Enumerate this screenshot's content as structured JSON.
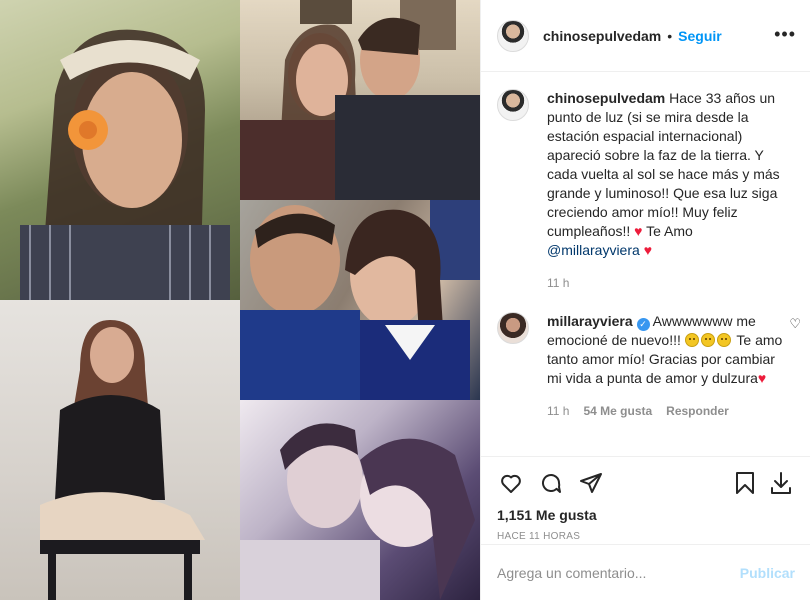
{
  "post_author": {
    "username": "chinosepulvedam",
    "separator": "•",
    "follow_label": "Seguir",
    "more_icon": "more-horizontal-icon"
  },
  "caption": {
    "username": "chinosepulvedam",
    "text": "Hace 33 años un punto de luz (si se mira desde la estación espacial internacional) apareció sobre la faz de la tierra. Y cada vuelta al sol se hace más y más grande y luminoso!! Que esa luz siga creciendo amor mío!! Muy feliz cumpleaños!!",
    "text_after_heart": "Te Amo",
    "mention": "@millarayviera",
    "time": "11 h"
  },
  "comment": {
    "username": "millarayviera",
    "text_before_emoji": "Awwwwwww me emocioné de nuevo!!!",
    "text_after_emoji": "Te amo tanto amor mío! Gracias por cambiar mi vida a punta de amor y dulzura",
    "time": "11 h",
    "likes": "54 Me gusta",
    "reply_label": "Responder"
  },
  "actions": {
    "likes_text": "1,151 Me gusta",
    "timestamp": "HACE 11 HORAS"
  },
  "add_comment": {
    "placeholder": "Agrega un comentario...",
    "publish_label": "Publicar"
  },
  "colors": {
    "accent": "#0095f6",
    "mention": "#00376b",
    "heart": "#ed1c3b",
    "muted": "#8e8e8e",
    "publish_disabled": "#b2dffc"
  }
}
